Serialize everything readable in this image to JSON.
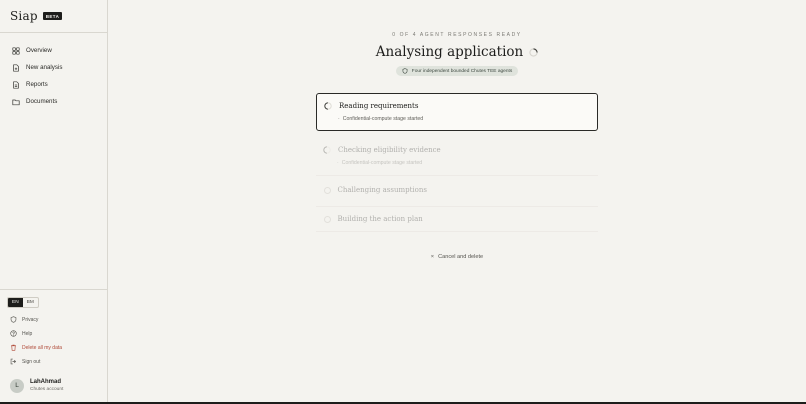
{
  "brand": {
    "name": "Siap",
    "badge": "BETA"
  },
  "nav": [
    {
      "label": "Overview",
      "icon": "grid-icon"
    },
    {
      "label": "New analysis",
      "icon": "file-plus-icon"
    },
    {
      "label": "Reports",
      "icon": "report-icon"
    },
    {
      "label": "Documents",
      "icon": "folder-icon"
    }
  ],
  "languages": [
    "EN",
    "BM"
  ],
  "active_language": "EN",
  "utility": {
    "privacy": "Privacy",
    "help": "Help",
    "delete": "Delete all my data",
    "signout": "Sign out"
  },
  "user": {
    "initial": "L",
    "name": "LahAhmad",
    "sub": "Chutes account"
  },
  "main": {
    "kicker": "0 OF 4 AGENT RESPONSES READY",
    "title": "Analysing application",
    "pill": "Four independent bounded Chutes TEE agents",
    "steps": [
      {
        "title": "Reading requirements",
        "detail": "Confidential-compute stage started"
      },
      {
        "title": "Checking eligibility evidence",
        "detail": "Confidential-compute stage started"
      },
      {
        "title": "Challenging assumptions"
      },
      {
        "title": "Building the action plan"
      }
    ],
    "cancel": "Cancel and delete"
  },
  "colors": {
    "background": "#f4f3ef",
    "ink": "#1d1d1b",
    "pill": "#dfe3dc",
    "danger": "#b04a38"
  }
}
